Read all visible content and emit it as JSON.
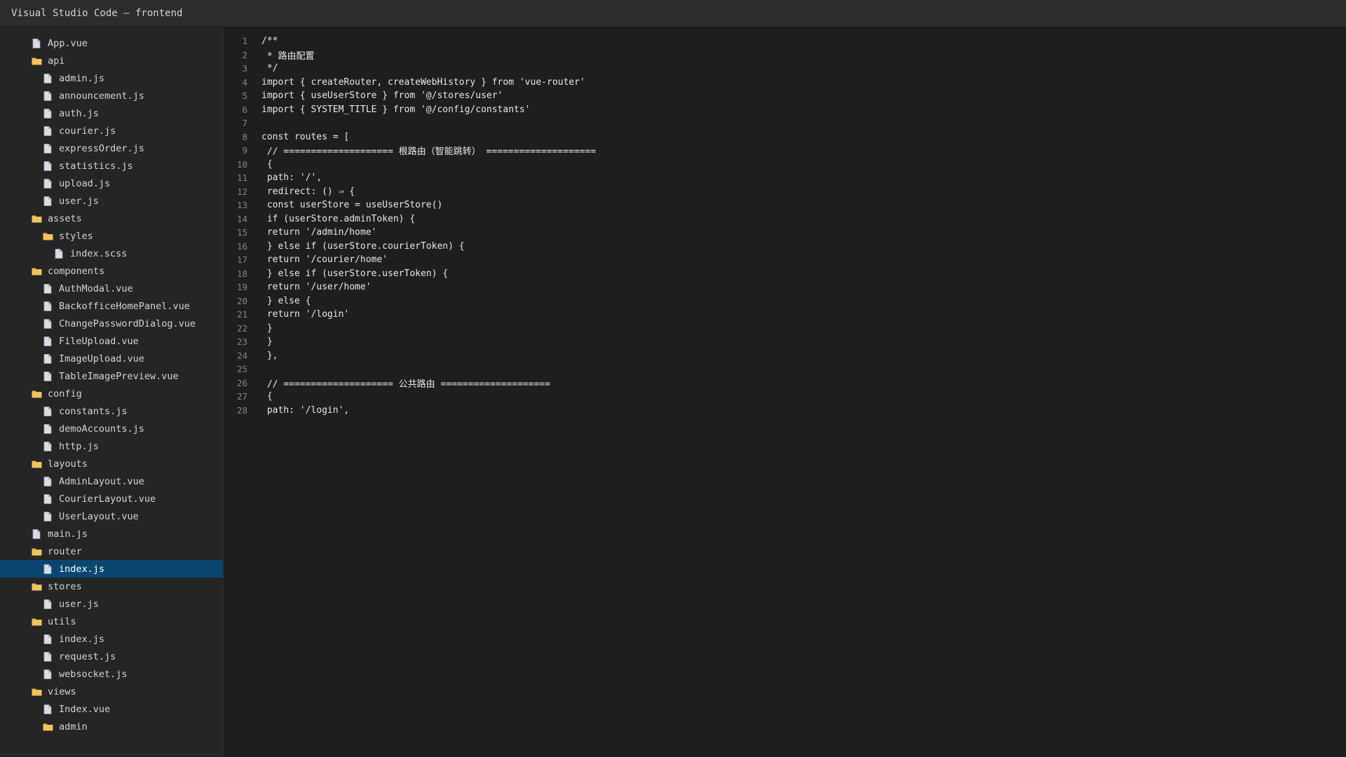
{
  "window": {
    "title": "Visual Studio Code — frontend"
  },
  "colors": {
    "selection": "#094771",
    "sidebar_bg": "#252526",
    "editor_bg": "#1e1e1e",
    "titlebar_bg": "#2c2c2c",
    "folder_icon": "#e8b84a",
    "file_icon": "#d8dde6"
  },
  "explorer": {
    "items": [
      {
        "label": "App.vue",
        "type": "file",
        "level": 0,
        "icon": "file-icon"
      },
      {
        "label": "api",
        "type": "folder",
        "level": 0,
        "icon": "folder-icon"
      },
      {
        "label": "admin.js",
        "type": "file",
        "level": 1,
        "icon": "file-icon"
      },
      {
        "label": "announcement.js",
        "type": "file",
        "level": 1,
        "icon": "file-icon"
      },
      {
        "label": "auth.js",
        "type": "file",
        "level": 1,
        "icon": "file-icon"
      },
      {
        "label": "courier.js",
        "type": "file",
        "level": 1,
        "icon": "file-icon"
      },
      {
        "label": "expressOrder.js",
        "type": "file",
        "level": 1,
        "icon": "file-icon"
      },
      {
        "label": "statistics.js",
        "type": "file",
        "level": 1,
        "icon": "file-icon"
      },
      {
        "label": "upload.js",
        "type": "file",
        "level": 1,
        "icon": "file-icon"
      },
      {
        "label": "user.js",
        "type": "file",
        "level": 1,
        "icon": "file-icon"
      },
      {
        "label": "assets",
        "type": "folder",
        "level": 0,
        "icon": "folder-icon"
      },
      {
        "label": "styles",
        "type": "folder",
        "level": 1,
        "icon": "folder-icon"
      },
      {
        "label": "index.scss",
        "type": "file",
        "level": 2,
        "icon": "file-icon"
      },
      {
        "label": "components",
        "type": "folder",
        "level": 0,
        "icon": "folder-icon"
      },
      {
        "label": "AuthModal.vue",
        "type": "file",
        "level": 1,
        "icon": "file-icon"
      },
      {
        "label": "BackofficeHomePanel.vue",
        "type": "file",
        "level": 1,
        "icon": "file-icon"
      },
      {
        "label": "ChangePasswordDialog.vue",
        "type": "file",
        "level": 1,
        "icon": "file-icon"
      },
      {
        "label": "FileUpload.vue",
        "type": "file",
        "level": 1,
        "icon": "file-icon"
      },
      {
        "label": "ImageUpload.vue",
        "type": "file",
        "level": 1,
        "icon": "file-icon"
      },
      {
        "label": "TableImagePreview.vue",
        "type": "file",
        "level": 1,
        "icon": "file-icon"
      },
      {
        "label": "config",
        "type": "folder",
        "level": 0,
        "icon": "folder-icon"
      },
      {
        "label": "constants.js",
        "type": "file",
        "level": 1,
        "icon": "file-icon"
      },
      {
        "label": "demoAccounts.js",
        "type": "file",
        "level": 1,
        "icon": "file-icon"
      },
      {
        "label": "http.js",
        "type": "file",
        "level": 1,
        "icon": "file-icon"
      },
      {
        "label": "layouts",
        "type": "folder",
        "level": 0,
        "icon": "folder-icon"
      },
      {
        "label": "AdminLayout.vue",
        "type": "file",
        "level": 1,
        "icon": "file-icon"
      },
      {
        "label": "CourierLayout.vue",
        "type": "file",
        "level": 1,
        "icon": "file-icon"
      },
      {
        "label": "UserLayout.vue",
        "type": "file",
        "level": 1,
        "icon": "file-icon"
      },
      {
        "label": "main.js",
        "type": "file",
        "level": 0,
        "icon": "file-icon"
      },
      {
        "label": "router",
        "type": "folder",
        "level": 0,
        "icon": "folder-icon"
      },
      {
        "label": "index.js",
        "type": "file",
        "level": 1,
        "icon": "file-icon",
        "selected": true
      },
      {
        "label": "stores",
        "type": "folder",
        "level": 0,
        "icon": "folder-icon"
      },
      {
        "label": "user.js",
        "type": "file",
        "level": 1,
        "icon": "file-icon"
      },
      {
        "label": "utils",
        "type": "folder",
        "level": 0,
        "icon": "folder-icon"
      },
      {
        "label": "index.js",
        "type": "file",
        "level": 1,
        "icon": "file-icon"
      },
      {
        "label": "request.js",
        "type": "file",
        "level": 1,
        "icon": "file-icon"
      },
      {
        "label": "websocket.js",
        "type": "file",
        "level": 1,
        "icon": "file-icon"
      },
      {
        "label": "views",
        "type": "folder",
        "level": 0,
        "icon": "folder-icon"
      },
      {
        "label": "Index.vue",
        "type": "file",
        "level": 1,
        "icon": "file-icon"
      },
      {
        "label": "admin",
        "type": "folder",
        "level": 1,
        "icon": "folder-icon"
      }
    ]
  },
  "editor": {
    "lines": [
      {
        "number": "1",
        "text": "/**"
      },
      {
        "number": "2",
        "text": " * 路由配置"
      },
      {
        "number": "3",
        "text": " */"
      },
      {
        "number": "4",
        "text": "import { createRouter, createWebHistory } from 'vue-router'"
      },
      {
        "number": "5",
        "text": "import { useUserStore } from '@/stores/user'"
      },
      {
        "number": "6",
        "text": "import { SYSTEM_TITLE } from '@/config/constants'"
      },
      {
        "number": "7",
        "text": ""
      },
      {
        "number": "8",
        "text": "const routes = ["
      },
      {
        "number": "9",
        "text": " // ==================== 根路由（智能跳转） ===================="
      },
      {
        "number": "10",
        "text": " {"
      },
      {
        "number": "11",
        "text": " path: '/',"
      },
      {
        "number": "12",
        "text": " redirect: () ⇒ {"
      },
      {
        "number": "13",
        "text": " const userStore = useUserStore()"
      },
      {
        "number": "14",
        "text": " if (userStore.adminToken) {"
      },
      {
        "number": "15",
        "text": " return '/admin/home'"
      },
      {
        "number": "16",
        "text": " } else if (userStore.courierToken) {"
      },
      {
        "number": "17",
        "text": " return '/courier/home'"
      },
      {
        "number": "18",
        "text": " } else if (userStore.userToken) {"
      },
      {
        "number": "19",
        "text": " return '/user/home'"
      },
      {
        "number": "20",
        "text": " } else {"
      },
      {
        "number": "21",
        "text": " return '/login'"
      },
      {
        "number": "22",
        "text": " }"
      },
      {
        "number": "23",
        "text": " }"
      },
      {
        "number": "24",
        "text": " },"
      },
      {
        "number": "25",
        "text": ""
      },
      {
        "number": "26",
        "text": " // ==================== 公共路由 ===================="
      },
      {
        "number": "27",
        "text": " {"
      },
      {
        "number": "28",
        "text": " path: '/login',"
      }
    ]
  }
}
